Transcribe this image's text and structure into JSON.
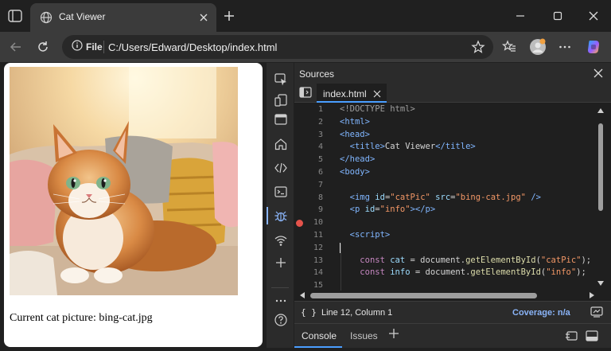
{
  "browser": {
    "tab_title": "Cat Viewer",
    "address_file_label": "File",
    "address_url": "C:/Users/Edward/Desktop/index.html"
  },
  "page": {
    "image_alt": "Fluffy orange and white cat on a cozy sunlit couch",
    "info_text": "Current cat picture: bing-cat.jpg"
  },
  "devtools": {
    "panel_title": "Sources",
    "file_tab": "index.html",
    "code_lines": [
      {
        "n": "1",
        "text": "<!DOCTYPE html>"
      },
      {
        "n": "2",
        "text": "<html>"
      },
      {
        "n": "3",
        "text": "<head>"
      },
      {
        "n": "4",
        "text": "  <title>Cat Viewer</title>"
      },
      {
        "n": "5",
        "text": "</head>"
      },
      {
        "n": "6",
        "text": "<body>"
      },
      {
        "n": "7",
        "text": ""
      },
      {
        "n": "8",
        "text": "  <img id=\"catPic\" src=\"bing-cat.jpg\" />"
      },
      {
        "n": "9",
        "text": "  <p id=\"info\"></p>"
      },
      {
        "n": "10",
        "text": ""
      },
      {
        "n": "11",
        "text": "  <script>"
      },
      {
        "n": "12",
        "text": ""
      },
      {
        "n": "13",
        "text": "    const cat = document.getElementById(\"catPic\");"
      },
      {
        "n": "14",
        "text": "    const info = document.getElementById(\"info\");"
      },
      {
        "n": "15",
        "text": ""
      }
    ],
    "breakpoint_line": "10",
    "status_braces": "{ }",
    "status_position": "Line 12, Column 1",
    "coverage": "Coverage: n/a",
    "drawer_tabs": [
      "Console",
      "Issues"
    ]
  },
  "colors": {
    "accent": "#4a9eff",
    "breakpoint": "#e5534b",
    "copilot_gradient": [
      "#2aa8ff",
      "#9b5cff",
      "#ffb347"
    ]
  },
  "icons": {
    "tab": "globe-icon",
    "back": "arrow-left-icon",
    "reload": "refresh-icon",
    "info": "info-icon",
    "favorite": "star-icon",
    "collections": "star-list-icon",
    "profile": "avatar-icon",
    "more": "ellipsis-icon",
    "copilot": "copilot-icon"
  }
}
